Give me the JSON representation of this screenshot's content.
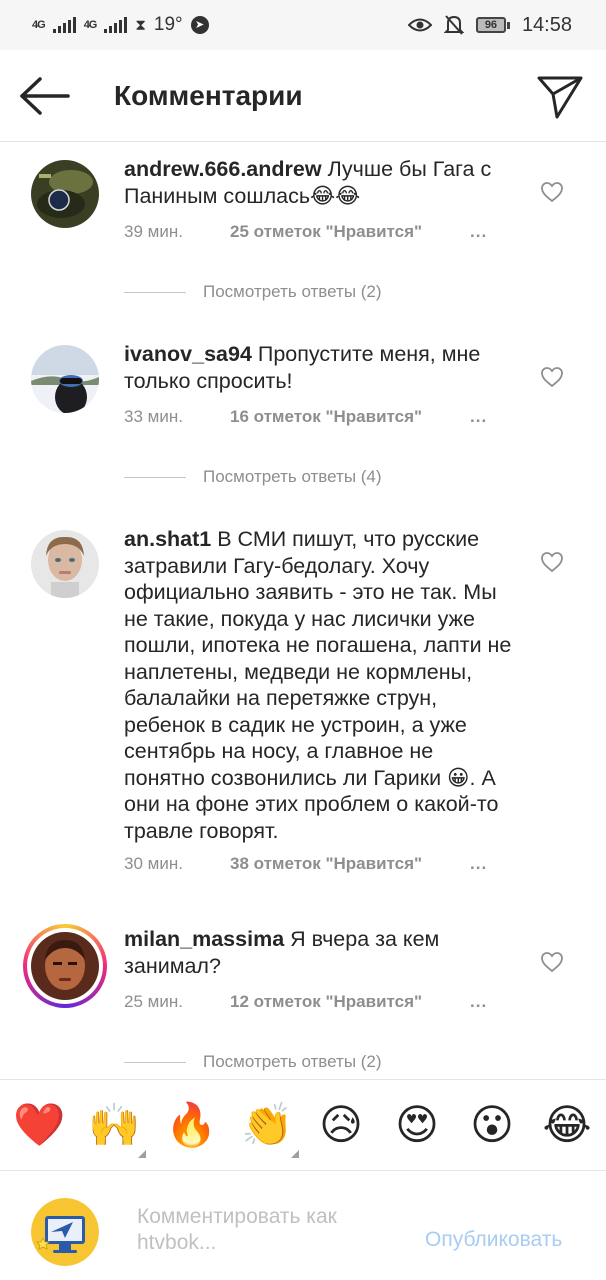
{
  "status_bar": {
    "network1": "4G",
    "network2": "4G",
    "temperature": "19°",
    "battery": "96",
    "time": "14:58"
  },
  "header": {
    "title": "Комментарии"
  },
  "comments": [
    {
      "username": "andrew.666.andrew",
      "text": "Лучше бы Гага с Паниным сошлась😂😂",
      "time": "39 мин.",
      "likes": "25 отметок \"Нравится\"",
      "more": "...",
      "replies": "Посмотреть ответы (2)"
    },
    {
      "username": "ivanov_sa94",
      "text": "Пропустите меня, мне только спросить!",
      "time": "33 мин.",
      "likes": "16 отметок \"Нравится\"",
      "more": "...",
      "replies": "Посмотреть ответы (4)"
    },
    {
      "username": "an.shat1",
      "text": "В СМИ пишут, что русские затравили Гагу-бедолагу. Хочу официально заявить - это не так. Мы не такие, покуда у нас лисички уже пошли, ипотека не погашена, лапти не наплетены, медведи не кормлены, балалайки на перетяжке струн, ребенок в садик не устроин, а уже сентябрь на носу, а главное не понятно созвонились ли Гарики 😀. А они на фоне этих проблем о какой-то травле говорят.",
      "time": "30 мин.",
      "likes": "38 отметок \"Нравится\"",
      "more": "..."
    },
    {
      "username": "milan_massima",
      "text": "Я вчера за кем занимал?",
      "time": "25 мин.",
      "likes": "12 отметок \"Нравится\"",
      "more": "...",
      "replies": "Посмотреть ответы (2)"
    }
  ],
  "emoji_bar": [
    "❤️",
    "🙌",
    "🔥",
    "👏",
    "😥",
    "😍",
    "😮",
    "😂"
  ],
  "input": {
    "placeholder": "Комментировать как htvbok...",
    "publish_label": "Опубликовать"
  },
  "colors": {
    "text": "#262626",
    "meta": "#8e8e8e",
    "publish": "#a7cdf2",
    "heart": "#e0245e"
  }
}
